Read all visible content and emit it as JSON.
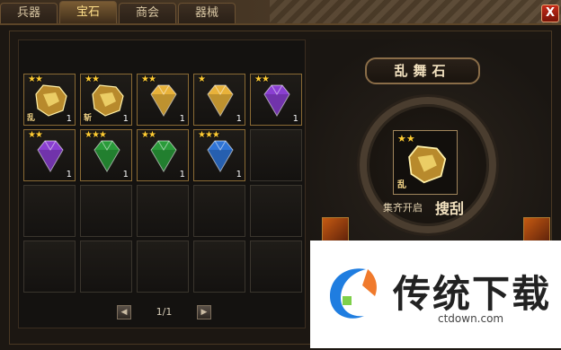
{
  "tabs": [
    {
      "label": "兵器",
      "active": false
    },
    {
      "label": "宝石",
      "active": true
    },
    {
      "label": "商会",
      "active": false
    },
    {
      "label": "器械",
      "active": false
    }
  ],
  "close_label": "X",
  "inventory": {
    "items": [
      {
        "type": "rock",
        "color": "gold",
        "stars": "★★",
        "tag": "乱",
        "count": "1"
      },
      {
        "type": "rock",
        "color": "gold",
        "stars": "★★",
        "tag": "斩",
        "count": "1"
      },
      {
        "type": "gem",
        "color": "gold",
        "stars": "★★",
        "tag": "",
        "count": "1"
      },
      {
        "type": "gem",
        "color": "gold",
        "stars": "★",
        "tag": "",
        "count": "1"
      },
      {
        "type": "gem",
        "color": "purple",
        "stars": "★★",
        "tag": "",
        "count": "1"
      },
      {
        "type": "gem",
        "color": "purple",
        "stars": "★★",
        "tag": "",
        "count": "1"
      },
      {
        "type": "gem",
        "color": "green",
        "stars": "★★★",
        "tag": "",
        "count": "1"
      },
      {
        "type": "gem",
        "color": "green",
        "stars": "★★",
        "tag": "",
        "count": "1"
      },
      {
        "type": "gem",
        "color": "blue",
        "stars": "★★★",
        "tag": "",
        "count": "1"
      }
    ],
    "page": "1/1",
    "prev_icon": "triangle-left-icon",
    "next_icon": "triangle-right-icon"
  },
  "detail": {
    "title": "乱舞石",
    "item": {
      "stars": "★★",
      "tag": "乱",
      "color": "gold"
    },
    "collect_small": "集齐开启",
    "collect_big": "搜刮"
  },
  "watermark": {
    "brand": "传统下载",
    "url": "ctdown.com"
  },
  "colors": {
    "gold": "#e8b23a",
    "purple": "#8a3fd1",
    "green": "#2a9b3a",
    "blue": "#2f74d6"
  }
}
